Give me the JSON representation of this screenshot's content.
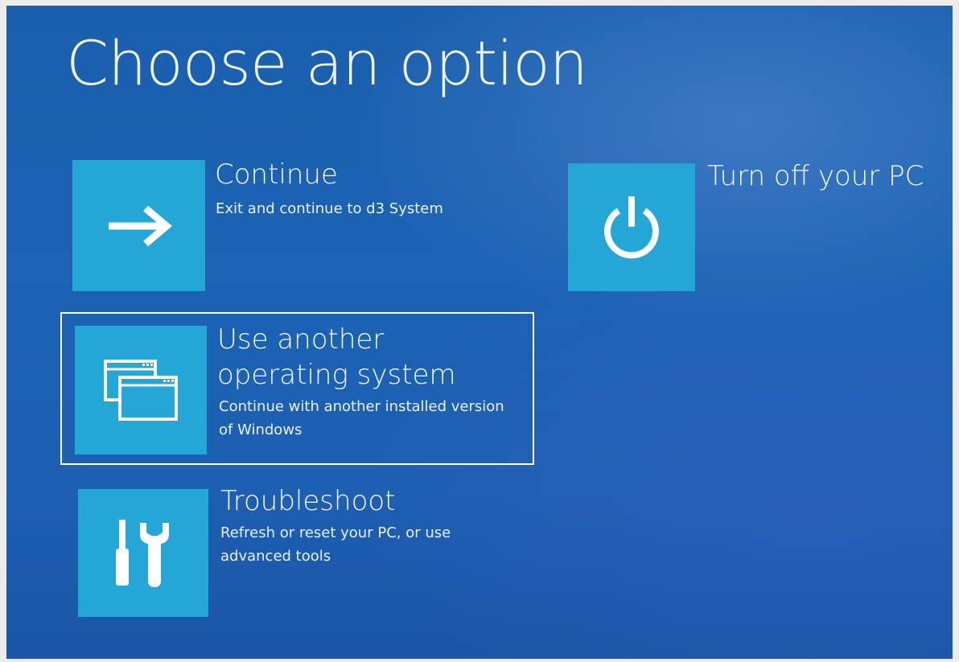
{
  "page": {
    "title": "Choose an option"
  },
  "options": {
    "continue": {
      "title": "Continue",
      "description": "Exit and continue to d3 System",
      "icon": "arrow-right-icon"
    },
    "turn_off": {
      "title": "Turn off your PC",
      "icon": "power-icon"
    },
    "another_os": {
      "title_line1": "Use another",
      "title_line2": "operating system",
      "description_line1": "Continue with another installed version",
      "description_line2": "of Windows",
      "icon": "windows-stack-icon"
    },
    "troubleshoot": {
      "title": "Troubleshoot",
      "description_line1": "Refresh or reset your PC, or use",
      "description_line2": "advanced tools",
      "icon": "tools-icon"
    }
  },
  "colors": {
    "background": "#1c63b4",
    "tile": "#24a7d6",
    "text": "#ffffff"
  }
}
